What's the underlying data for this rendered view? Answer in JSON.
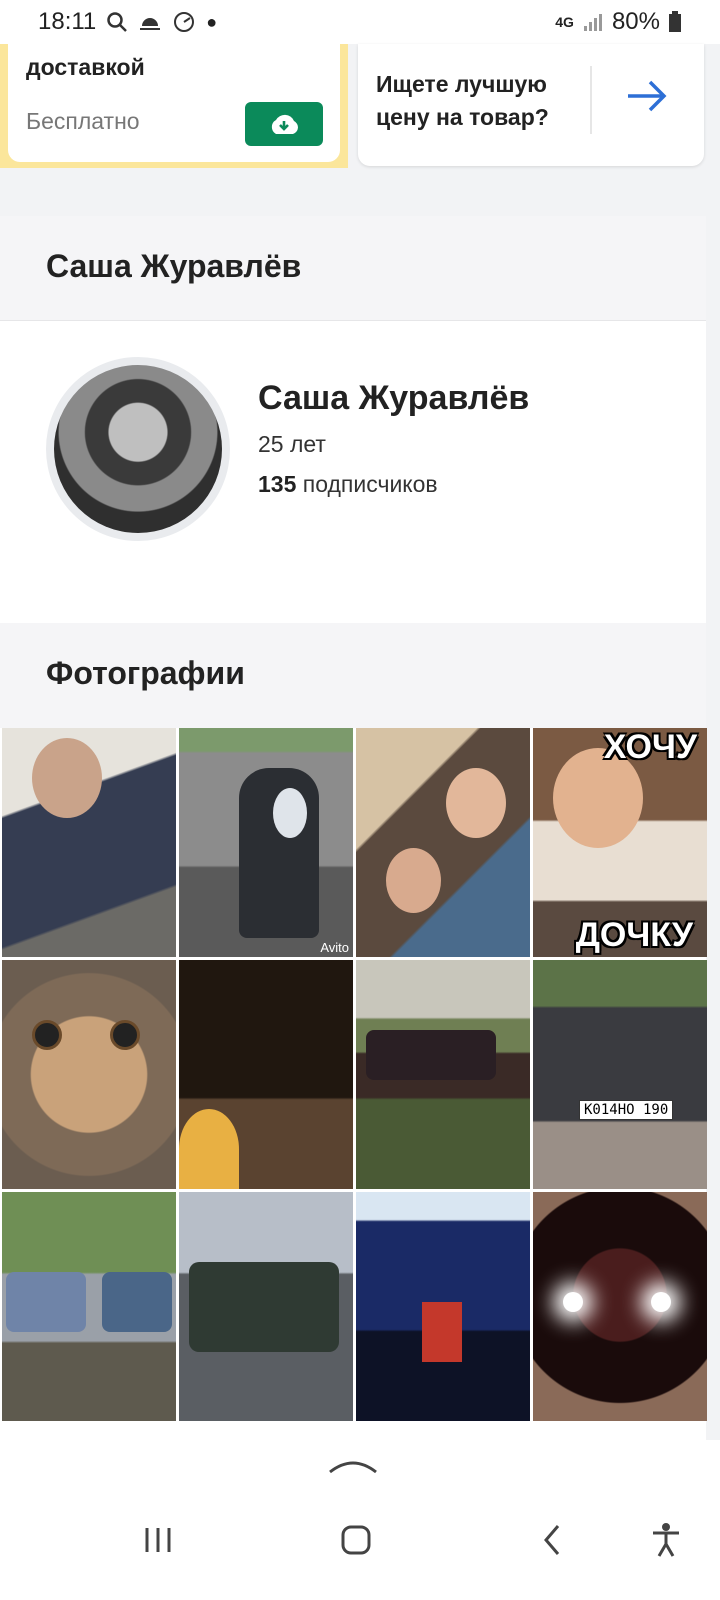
{
  "statusbar": {
    "time": "18:11",
    "network": "4G",
    "battery": "80%"
  },
  "ad_cards": {
    "left": {
      "title": "доставкой",
      "price": "Бесплатно",
      "icon": "cloud-download-icon"
    },
    "right": {
      "text": "Ищете лучшую цену на товар?",
      "icon": "arrow-right-icon"
    }
  },
  "user_header": {
    "title": "Саша Журавлёв"
  },
  "profile": {
    "name": "Саша Журавлёв",
    "age": "25 лет",
    "subs_count": "135",
    "subs_label": "подписчиков"
  },
  "photos_header": {
    "title": "Фотографии"
  },
  "photos": {
    "p4_top_text": "ХОЧУ",
    "p4_bottom_text": "ДОЧКУ",
    "p2_watermark": "Avito",
    "p8_plate": "К014НО 190"
  },
  "navbar": {
    "icons": [
      "recent-apps-icon",
      "home-icon",
      "back-icon",
      "accessibility-icon"
    ]
  },
  "colors": {
    "accent_green": "#0b8a5a",
    "ad_yellow": "#fbe69b",
    "arrow_blue": "#2d6fd6"
  }
}
